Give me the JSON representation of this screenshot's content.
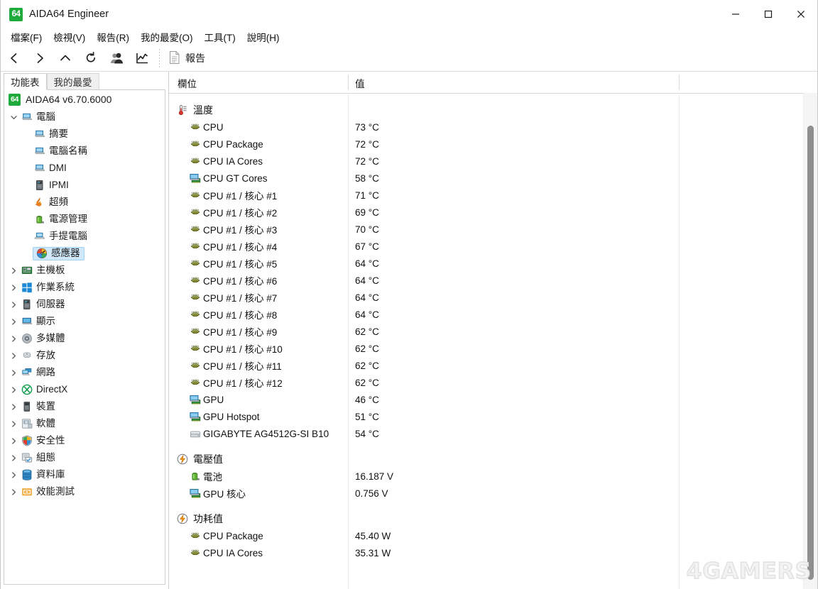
{
  "window": {
    "title": "AIDA64 Engineer",
    "logo_text": "64",
    "minimize_icon": "minimize-icon",
    "maximize_icon": "maximize-icon",
    "close_icon": "close-icon"
  },
  "menubar": {
    "items": [
      {
        "label": "檔案(F)",
        "name": "menu-file"
      },
      {
        "label": "檢視(V)",
        "name": "menu-view"
      },
      {
        "label": "報告(R)",
        "name": "menu-report"
      },
      {
        "label": "我的最愛(O)",
        "name": "menu-favorites"
      },
      {
        "label": "工具(T)",
        "name": "menu-tools"
      },
      {
        "label": "說明(H)",
        "name": "menu-help"
      }
    ]
  },
  "toolbar": {
    "buttons": [
      {
        "icon": "back-icon",
        "name": "toolbar-back"
      },
      {
        "icon": "forward-icon",
        "name": "toolbar-forward"
      },
      {
        "icon": "up-icon",
        "name": "toolbar-up"
      },
      {
        "icon": "refresh-icon",
        "name": "toolbar-refresh"
      },
      {
        "icon": "users-icon",
        "name": "toolbar-users"
      },
      {
        "icon": "chart-icon",
        "name": "toolbar-chart"
      }
    ],
    "report_label": "報告",
    "report_icon": "document-icon"
  },
  "sidebar": {
    "tabs": [
      {
        "label": "功能表",
        "active": true
      },
      {
        "label": "我的最愛",
        "active": false
      }
    ],
    "root": {
      "label": "AIDA64 v6.70.6000",
      "logo_text": "64"
    },
    "items": [
      {
        "label": "電腦",
        "icon": "computer-icon",
        "level": 1,
        "expanded": true,
        "chevron": "down",
        "selected": false
      },
      {
        "label": "摘要",
        "icon": "computer-icon",
        "level": 2,
        "expanded": false,
        "chevron": "",
        "selected": false
      },
      {
        "label": "電腦名稱",
        "icon": "computer-icon",
        "level": 2,
        "expanded": false,
        "chevron": "",
        "selected": false
      },
      {
        "label": "DMI",
        "icon": "computer-icon",
        "level": 2,
        "expanded": false,
        "chevron": "",
        "selected": false
      },
      {
        "label": "IPMI",
        "icon": "server-icon",
        "level": 2,
        "expanded": false,
        "chevron": "",
        "selected": false
      },
      {
        "label": "超頻",
        "icon": "flame-icon",
        "level": 2,
        "expanded": false,
        "chevron": "",
        "selected": false
      },
      {
        "label": "電源管理",
        "icon": "battery-icon",
        "level": 2,
        "expanded": false,
        "chevron": "",
        "selected": false
      },
      {
        "label": "手提電腦",
        "icon": "laptop-icon",
        "level": 2,
        "expanded": false,
        "chevron": "",
        "selected": false
      },
      {
        "label": "感應器",
        "icon": "sensor-icon",
        "level": 2,
        "expanded": false,
        "chevron": "",
        "selected": true
      },
      {
        "label": "主機板",
        "icon": "mainboard-icon",
        "level": 1,
        "expanded": false,
        "chevron": "right",
        "selected": false
      },
      {
        "label": "作業系統",
        "icon": "windows-icon",
        "level": 1,
        "expanded": false,
        "chevron": "right",
        "selected": false
      },
      {
        "label": "伺服器",
        "icon": "server-icon",
        "level": 1,
        "expanded": false,
        "chevron": "right",
        "selected": false
      },
      {
        "label": "顯示",
        "icon": "display-icon",
        "level": 1,
        "expanded": false,
        "chevron": "right",
        "selected": false
      },
      {
        "label": "多媒體",
        "icon": "speaker-icon",
        "level": 1,
        "expanded": false,
        "chevron": "right",
        "selected": false
      },
      {
        "label": "存放",
        "icon": "storage-icon",
        "level": 1,
        "expanded": false,
        "chevron": "right",
        "selected": false
      },
      {
        "label": "網路",
        "icon": "network-icon",
        "level": 1,
        "expanded": false,
        "chevron": "right",
        "selected": false
      },
      {
        "label": "DirectX",
        "icon": "directx-icon",
        "level": 1,
        "expanded": false,
        "chevron": "right",
        "selected": false
      },
      {
        "label": "裝置",
        "icon": "device-icon",
        "level": 1,
        "expanded": false,
        "chevron": "right",
        "selected": false
      },
      {
        "label": "軟體",
        "icon": "software-icon",
        "level": 1,
        "expanded": false,
        "chevron": "right",
        "selected": false
      },
      {
        "label": "安全性",
        "icon": "shield-icon",
        "level": 1,
        "expanded": false,
        "chevron": "right",
        "selected": false
      },
      {
        "label": "組態",
        "icon": "config-icon",
        "level": 1,
        "expanded": false,
        "chevron": "right",
        "selected": false
      },
      {
        "label": "資料庫",
        "icon": "database-icon",
        "level": 1,
        "expanded": false,
        "chevron": "right",
        "selected": false
      },
      {
        "label": "效能測試",
        "icon": "benchmark-icon",
        "level": 1,
        "expanded": false,
        "chevron": "right",
        "selected": false
      }
    ]
  },
  "content": {
    "columns": [
      {
        "label": "欄位",
        "name": "column-field"
      },
      {
        "label": "值",
        "name": "column-value"
      }
    ],
    "groups": [
      {
        "title": "溫度",
        "icon": "thermometer-icon",
        "rows": [
          {
            "label": "CPU",
            "value": "73 °C",
            "icon": "cpu-chip-icon"
          },
          {
            "label": "CPU Package",
            "value": "72 °C",
            "icon": "cpu-chip-icon"
          },
          {
            "label": "CPU IA Cores",
            "value": "72 °C",
            "icon": "cpu-chip-icon"
          },
          {
            "label": "CPU GT Cores",
            "value": "58 °C",
            "icon": "gpu-card-icon"
          },
          {
            "label": "CPU #1 / 核心 #1",
            "value": "71 °C",
            "icon": "cpu-chip-icon"
          },
          {
            "label": "CPU #1 / 核心 #2",
            "value": "69 °C",
            "icon": "cpu-chip-icon"
          },
          {
            "label": "CPU #1 / 核心 #3",
            "value": "70 °C",
            "icon": "cpu-chip-icon"
          },
          {
            "label": "CPU #1 / 核心 #4",
            "value": "67 °C",
            "icon": "cpu-chip-icon"
          },
          {
            "label": "CPU #1 / 核心 #5",
            "value": "64 °C",
            "icon": "cpu-chip-icon"
          },
          {
            "label": "CPU #1 / 核心 #6",
            "value": "64 °C",
            "icon": "cpu-chip-icon"
          },
          {
            "label": "CPU #1 / 核心 #7",
            "value": "64 °C",
            "icon": "cpu-chip-icon"
          },
          {
            "label": "CPU #1 / 核心 #8",
            "value": "64 °C",
            "icon": "cpu-chip-icon"
          },
          {
            "label": "CPU #1 / 核心 #9",
            "value": "62 °C",
            "icon": "cpu-chip-icon"
          },
          {
            "label": "CPU #1 / 核心 #10",
            "value": "62 °C",
            "icon": "cpu-chip-icon"
          },
          {
            "label": "CPU #1 / 核心 #11",
            "value": "62 °C",
            "icon": "cpu-chip-icon"
          },
          {
            "label": "CPU #1 / 核心 #12",
            "value": "62 °C",
            "icon": "cpu-chip-icon"
          },
          {
            "label": "GPU",
            "value": "46 °C",
            "icon": "gpu-card-icon"
          },
          {
            "label": "GPU Hotspot",
            "value": "51 °C",
            "icon": "gpu-card-icon"
          },
          {
            "label": "GIGABYTE AG4512G-SI B10",
            "value": "54 °C",
            "icon": "disk-icon"
          }
        ]
      },
      {
        "title": "電壓值",
        "icon": "bolt-icon",
        "rows": [
          {
            "label": "電池",
            "value": "16.187 V",
            "icon": "battery-icon"
          },
          {
            "label": "GPU 核心",
            "value": "0.756 V",
            "icon": "gpu-card-icon"
          }
        ]
      },
      {
        "title": "功耗值",
        "icon": "bolt-icon",
        "rows": [
          {
            "label": "CPU Package",
            "value": "45.40 W",
            "icon": "cpu-chip-icon"
          },
          {
            "label": "CPU IA Cores",
            "value": "35.31 W",
            "icon": "cpu-chip-icon"
          }
        ]
      }
    ]
  },
  "watermark": {
    "text": "4GAMERS"
  },
  "colors": {
    "accent_green": "#1faa3c",
    "selection_blue": "#cfe8fb",
    "chip_olive": "#6d7524",
    "gpu_blue": "#3d9ad9",
    "header_text": "#111111"
  }
}
